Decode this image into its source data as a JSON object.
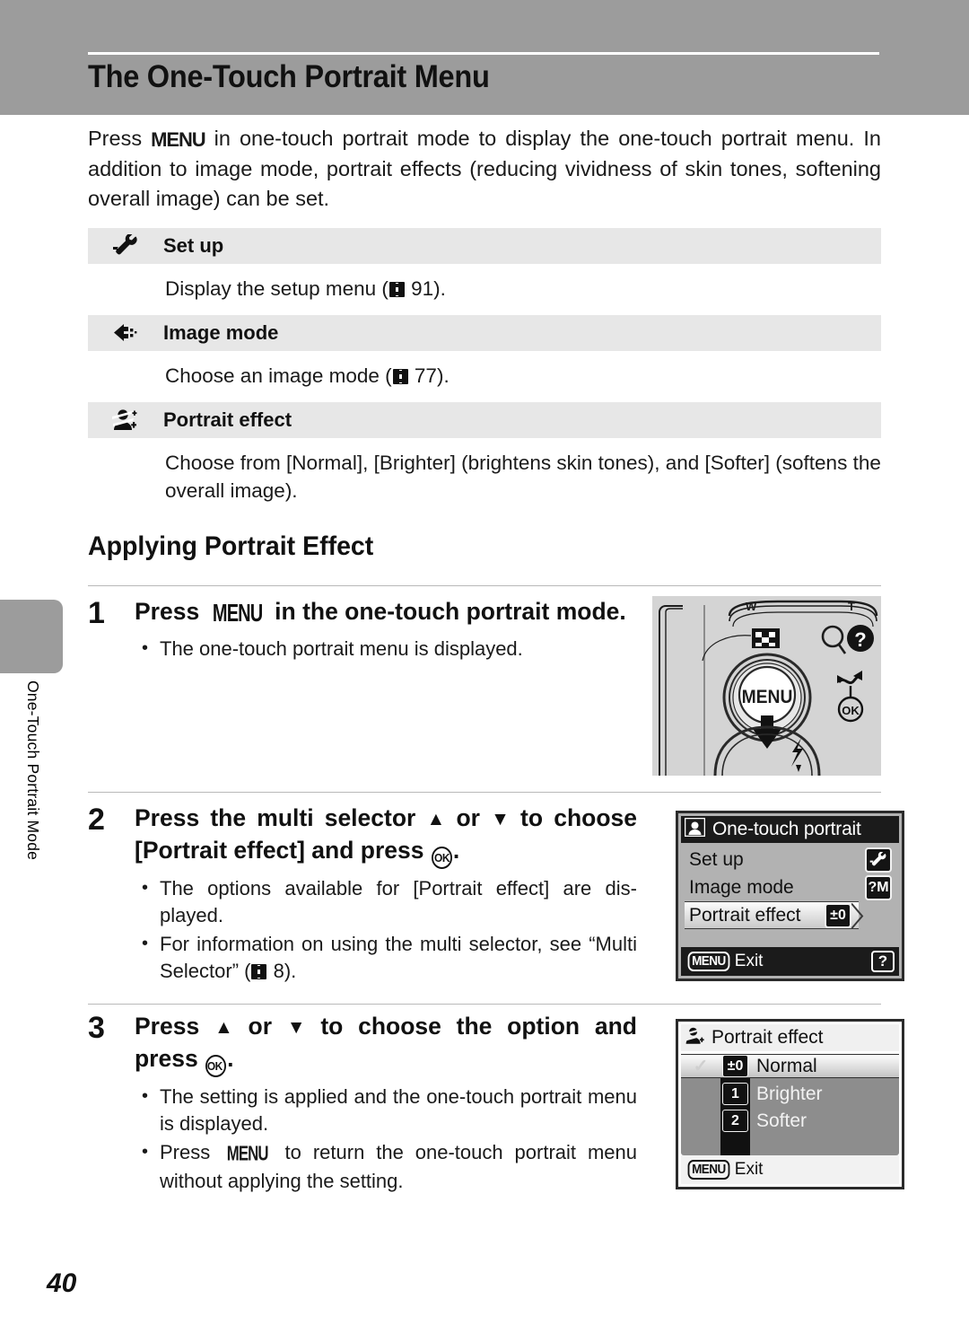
{
  "header": {
    "title": "The One-Touch Portrait Menu"
  },
  "side_tab": {
    "label": "One-Touch Portrait Mode"
  },
  "intro": {
    "part1": "Press ",
    "menu_glyph": "MENU",
    "part2": " in one-touch portrait mode to display the one-touch portrait menu. In addition to image mode, portrait effects (reducing vividness of skin tones, softening overall image) can be set."
  },
  "def_table": {
    "rows": [
      {
        "icon": "wrench-icon",
        "label": "Set up",
        "desc_before": "Display the setup menu (",
        "page_ref": "91",
        "desc_after": ")."
      },
      {
        "icon": "image-mode-icon",
        "label": "Image mode",
        "desc_before": "Choose an image mode (",
        "page_ref": "77",
        "desc_after": ")."
      },
      {
        "icon": "portrait-effect-icon",
        "label": "Portrait effect",
        "desc_before": "Choose from [Normal], [Brighter] (brightens skin tones), and [Softer] (softens the overall image).",
        "page_ref": "",
        "desc_after": ""
      }
    ]
  },
  "section": {
    "title": "Applying Portrait Effect"
  },
  "steps": [
    {
      "num": "1",
      "head_a": "Press ",
      "head_menu": "MENU",
      "head_b": " in the one-touch portrait mode.",
      "bullets": [
        {
          "text": "The one-touch portrait menu is displayed."
        }
      ]
    },
    {
      "num": "2",
      "head_a": "Press the multi selector ",
      "head_up": "▲",
      "head_mid": " or ",
      "head_down": "▼",
      "head_b": " to choose [Portrait effect] and press ",
      "head_ok": "OK",
      "head_c": ".",
      "bullets": [
        {
          "text": "The options available for [Portrait effect] are dis-played."
        },
        {
          "text_a": "For information on using the multi selector, see “Multi Selector” (",
          "page_ref": "8",
          "text_b": ")."
        }
      ]
    },
    {
      "num": "3",
      "head_a": "Press ",
      "head_up": "▲",
      "head_mid": " or ",
      "head_down": "▼",
      "head_b": " to choose the option and press ",
      "head_ok": "OK",
      "head_c": ".",
      "bullets": [
        {
          "text": "The setting is applied and the one-touch portrait menu is displayed."
        },
        {
          "text_a": "Press ",
          "menu_glyph": "MENU",
          "text_b": " to return the one-touch portrait menu without applying the setting."
        }
      ]
    }
  ],
  "camera_art": {
    "menu_button_label": "MENU",
    "ok_label": "OK"
  },
  "lcd_one_touch": {
    "title": "One-touch portrait",
    "title_icon": "one-touch-portrait-icon",
    "rows": [
      {
        "label": "Set up",
        "badge": "⚒",
        "badge_name": "wrench-badge-icon",
        "selected": false
      },
      {
        "label": "Image mode",
        "badge": "?M",
        "badge_name": "image-mode-badge-icon",
        "selected": false
      },
      {
        "label": "Portrait effect",
        "badge": "±0",
        "badge_name": "portrait-effect-badge-icon",
        "selected": true
      }
    ],
    "bottom": {
      "menu_pill": "MENU",
      "exit": "Exit",
      "help": "?"
    }
  },
  "lcd_portrait_effect": {
    "title": "Portrait effect",
    "title_icon": "portrait-effect-icon",
    "options": [
      {
        "check": "✓",
        "icon": "±0",
        "icon_name": "normal-icon",
        "label": "Normal",
        "selected": true
      },
      {
        "check": "",
        "icon": "1",
        "icon_name": "brighter-icon",
        "label": "Brighter",
        "selected": false
      },
      {
        "check": "",
        "icon": "2",
        "icon_name": "softer-icon",
        "label": "Softer",
        "selected": false
      }
    ],
    "bottom": {
      "menu_pill": "MENU",
      "exit": "Exit"
    }
  },
  "page_number": "40",
  "colors": {
    "header_band": "#9c9c9c",
    "table_row": "#e7e7e7",
    "rule": "#b9b9b9",
    "lcd_frame": "#2b2b2b"
  }
}
